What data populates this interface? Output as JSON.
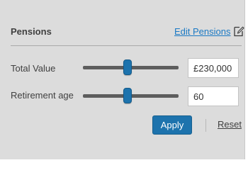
{
  "panel": {
    "title": "Pensions",
    "edit_link": "Edit Pensions",
    "edit_icon": "edit-document-icon"
  },
  "fields": [
    {
      "label": "Total Value",
      "value": "£230,000",
      "slider_fraction": 0.47
    },
    {
      "label": "Retirement age",
      "value": "60",
      "slider_fraction": 0.47
    }
  ],
  "actions": {
    "apply_label": "Apply",
    "reset_label": "Reset"
  },
  "colors": {
    "accent": "#1d73ad",
    "link": "#1a79c4",
    "panel_bg": "#dcdcdc",
    "track": "#5d5d5d"
  }
}
